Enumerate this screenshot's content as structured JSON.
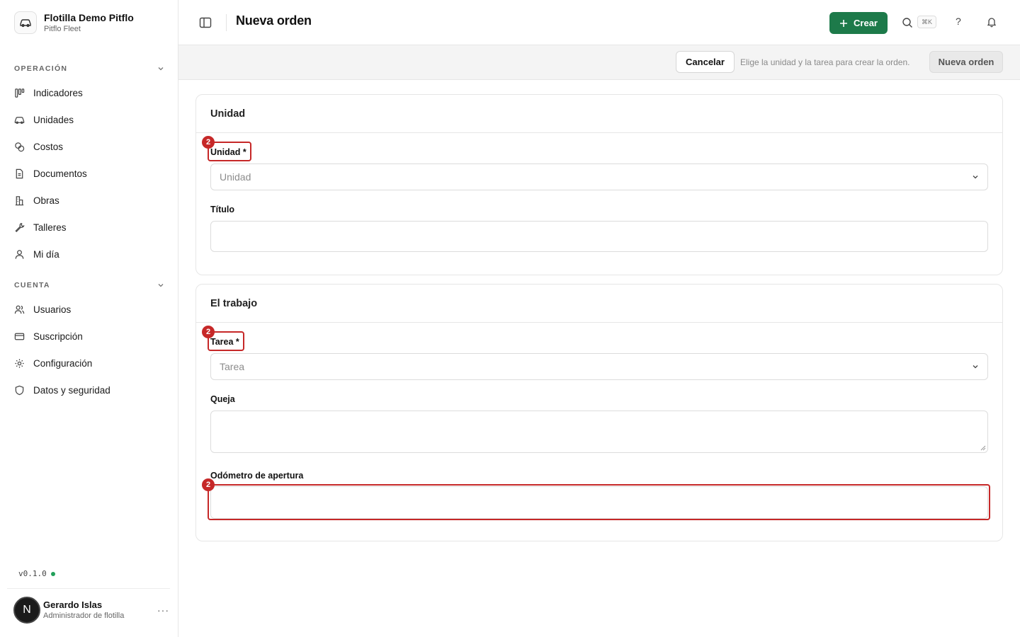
{
  "brand": {
    "title": "Flotilla Demo Pitflo",
    "subtitle": "Pitflo Fleet"
  },
  "sidebar": {
    "sections": [
      {
        "label": "OPERACIÓN",
        "items": [
          "Indicadores",
          "Unidades",
          "Costos",
          "Documentos",
          "Obras",
          "Talleres",
          "Mi día"
        ]
      },
      {
        "label": "CUENTA",
        "items": [
          "Usuarios",
          "Suscripción",
          "Configuración",
          "Datos y seguridad"
        ]
      }
    ],
    "version": "v0.1.0"
  },
  "user": {
    "initial": "N",
    "name": "Gerardo Islas",
    "role": "Administrador de flotilla",
    "more": "···"
  },
  "header": {
    "title": "Nueva orden",
    "create_label": "Crear",
    "shortcut": "⌘K",
    "help": "?"
  },
  "actions": {
    "cancel": "Cancelar",
    "hint": "Elige la unidad y la tarea para crear la orden.",
    "submit": "Nueva orden"
  },
  "form": {
    "card1": {
      "title": "Unidad",
      "unit_label": "Unidad *",
      "unit_placeholder": "Unidad",
      "title_label": "Título"
    },
    "card2": {
      "title": "El trabajo",
      "task_label": "Tarea *",
      "task_placeholder": "Tarea",
      "complaint_label": "Queja",
      "odometer_label": "Odómetro de apertura"
    }
  },
  "annotations": {
    "badge": "2"
  },
  "colors": {
    "primary": "#1d7a4a",
    "highlight": "#c62828",
    "status": "#22a05a"
  }
}
